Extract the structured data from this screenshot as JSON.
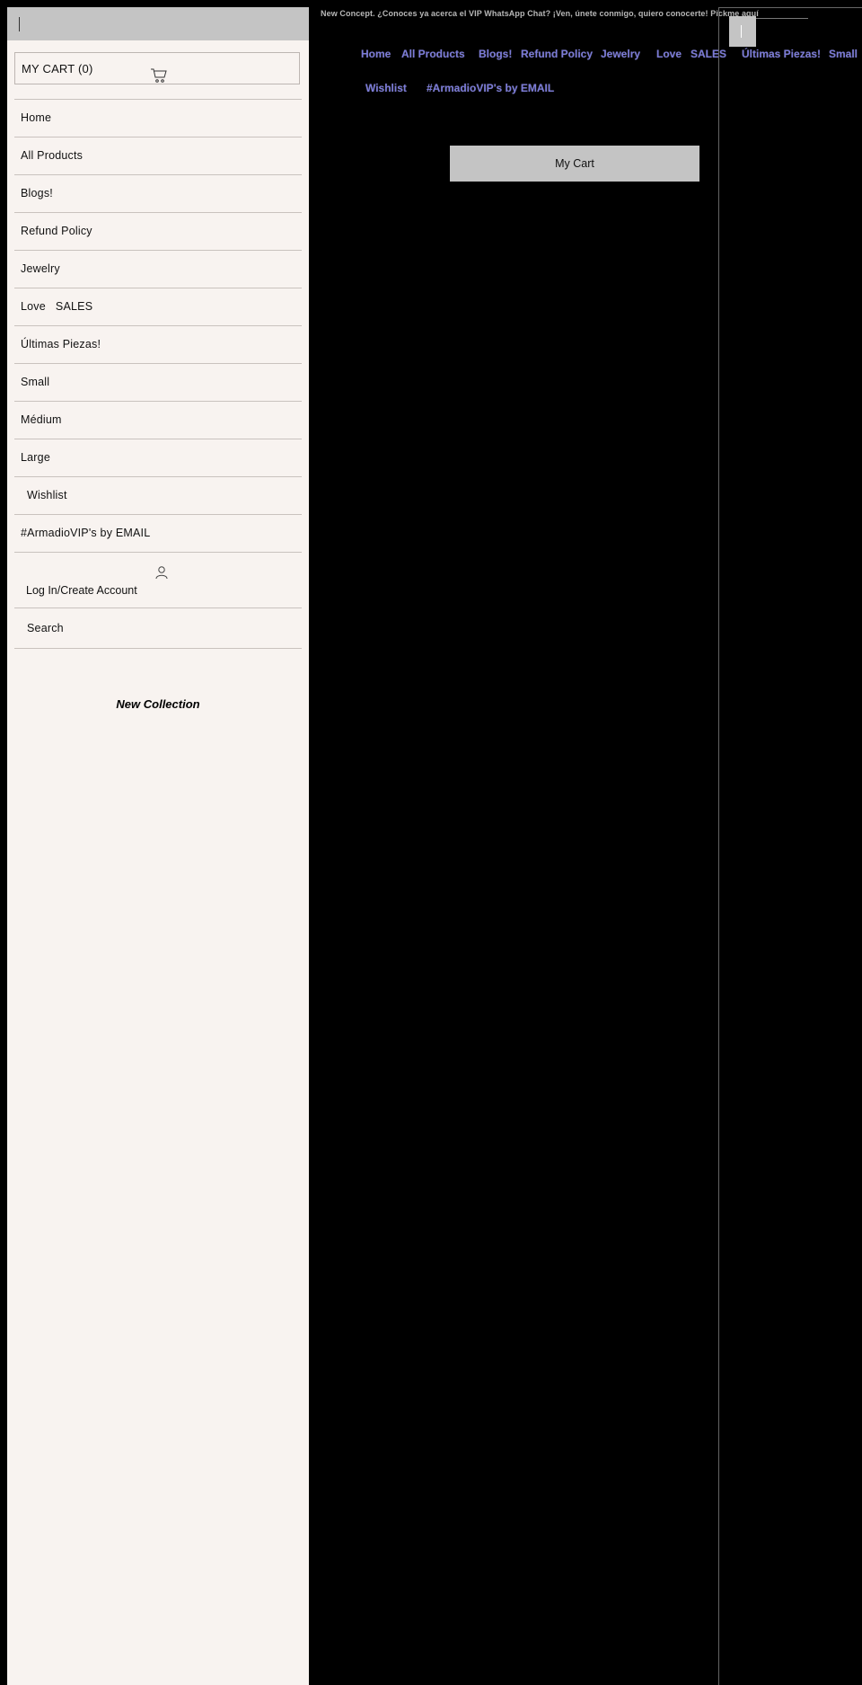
{
  "drawer": {
    "cart_label": "MY CART (0)",
    "cart_icon": "cart-icon",
    "menu": [
      {
        "label": "Home"
      },
      {
        "label": "All Products"
      },
      {
        "label": "Blogs!"
      },
      {
        "label": "Refund Policy"
      },
      {
        "label": "Jewelry"
      },
      {
        "label": "Love   SALES"
      },
      {
        "label": "Últimas Piezas!"
      },
      {
        "label": "Small"
      },
      {
        "label": "Médium"
      },
      {
        "label": "Large"
      },
      {
        "label": "Wishlist"
      },
      {
        "label": "#ArmadioVIP's by EMAIL"
      }
    ],
    "login_label": "Log In/Create Account",
    "login_icon": "user-icon",
    "search_label": "Search",
    "collection_title": "New Collection"
  },
  "header": {
    "promo": "New Concept. ¿Conoces ya acerca el VIP WhatsApp Chat? ¡Ven, únete conmigo, quiero conocerte! Pickme aquí",
    "nav": [
      {
        "label": "Home"
      },
      {
        "label": "All Products"
      },
      {
        "label": "Blogs!"
      },
      {
        "label": "Refund Policy"
      },
      {
        "label": "Jewelry"
      },
      {
        "label": "Love   SALES"
      },
      {
        "label": "Últimas Piezas!"
      },
      {
        "label": "Small"
      },
      {
        "label": "Wishlist"
      },
      {
        "label": "#ArmadioVIP's by EMAIL"
      }
    ],
    "mycart_label": "My Cart"
  },
  "colors": {
    "background": "#000000",
    "drawer_bg": "#f8f3f0",
    "gray": "#c4c4c4",
    "nav_link": "#7b7bd9"
  }
}
